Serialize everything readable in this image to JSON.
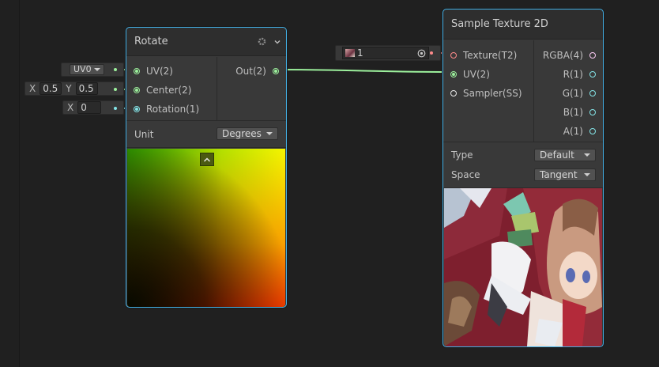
{
  "canvas": {
    "background": "#202020"
  },
  "external_inputs": {
    "uv_dropdown": "UV0",
    "center_x_label": "X",
    "center_x_value": "0.5",
    "center_y_label": "Y",
    "center_y_value": "0.5",
    "rotation_x_label": "X",
    "rotation_x_value": "0",
    "texture_field_value": "1"
  },
  "rotate_node": {
    "title": "Rotate",
    "inputs": [
      "UV(2)",
      "Center(2)",
      "Rotation(1)"
    ],
    "output": "Out(2)",
    "unit_label": "Unit",
    "unit_value": "Degrees"
  },
  "sample_node": {
    "title": "Sample Texture 2D",
    "inputs": [
      "Texture(T2)",
      "UV(2)",
      "Sampler(SS)"
    ],
    "outputs": [
      "RGBA(4)",
      "R(1)",
      "G(1)",
      "B(1)",
      "A(1)"
    ],
    "type_label": "Type",
    "type_value": "Default",
    "space_label": "Space",
    "space_value": "Tangent"
  },
  "colors": {
    "node_border": "#42b0e6",
    "vector2_port": "#9cf09c",
    "vector1_port": "#84e4e7",
    "texture_port": "#ff8b8b",
    "vector4_port": "#fbcbf4",
    "sampler_port": "#ffffff",
    "wire": "#9cf09c"
  },
  "icons": [
    "gear-icon",
    "chevron-down-icon",
    "collapse-arrow-icon",
    "object-picker-icon",
    "texture-thumbnail-icon"
  ]
}
